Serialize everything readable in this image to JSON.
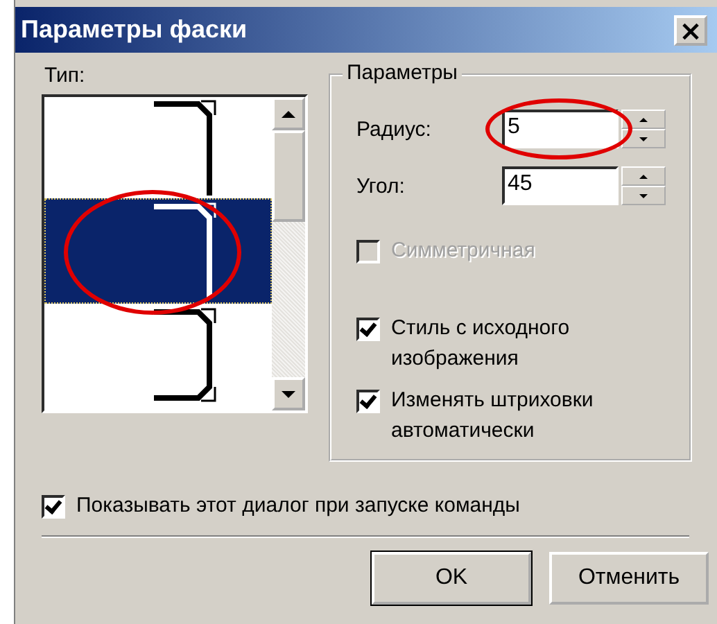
{
  "window": {
    "title": "Параметры фаски",
    "close": "×"
  },
  "type_list": {
    "label": "Тип:",
    "items": [
      {
        "kind": "top",
        "selected": false,
        "circled": false
      },
      {
        "kind": "top",
        "selected": true,
        "circled": true
      },
      {
        "kind": "both",
        "selected": false,
        "circled": false
      }
    ]
  },
  "parameters": {
    "title": "Параметры",
    "fields": [
      {
        "label": "Радиус:",
        "value": "5",
        "circled": true
      },
      {
        "label": "Угол:",
        "value": "45",
        "circled": false
      }
    ],
    "checkboxes": [
      {
        "label": "Симметричная",
        "checked": false,
        "disabled": true
      },
      {
        "label": "Стиль с исходного изображения",
        "checked": true,
        "disabled": false
      },
      {
        "label": "Изменять штриховки автоматически",
        "checked": true,
        "disabled": false
      }
    ]
  },
  "show_dialog": {
    "label": "Показывать этот диалог при запуске команды",
    "checked": true
  },
  "buttons": [
    {
      "label": "OK",
      "default": true
    },
    {
      "label": "Отменить",
      "default": false
    }
  ]
}
